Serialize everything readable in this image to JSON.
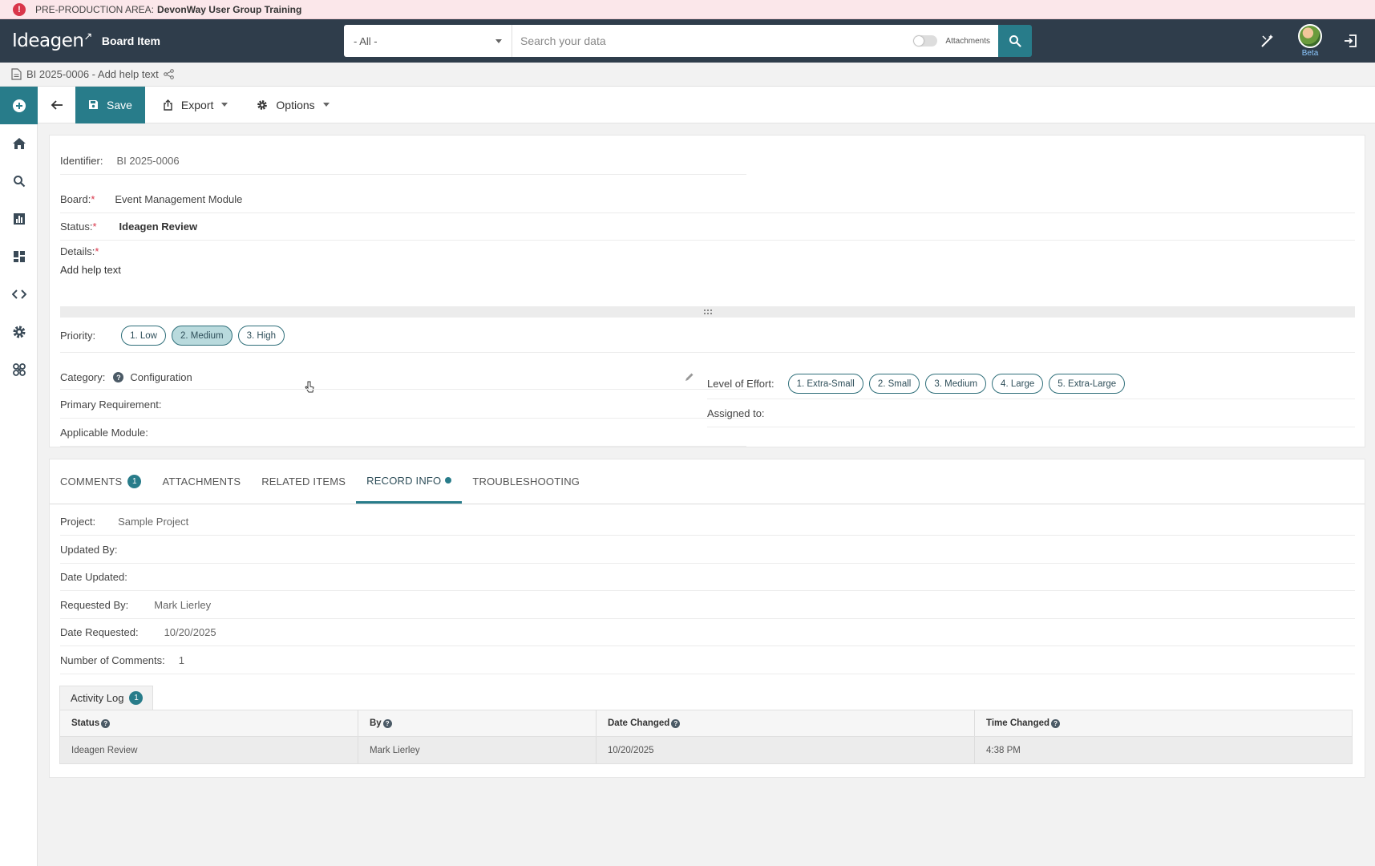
{
  "banner": {
    "label": "PRE-PRODUCTION AREA:",
    "name": "DevonWay User Group Training"
  },
  "header": {
    "logo": "Ideagen",
    "app_title": "Board Item",
    "scope_value": "- All -",
    "search_placeholder": "Search your data",
    "attachments_label": "Attachments",
    "beta_label": "Beta"
  },
  "breadcrumb": {
    "title": "BI 2025-0006 - Add help text"
  },
  "toolbar": {
    "save_label": "Save",
    "export_label": "Export",
    "options_label": "Options"
  },
  "record": {
    "identifier_label": "Identifier:",
    "identifier_value": "BI 2025-0006",
    "board_label": "Board:",
    "board_value": "Event Management Module",
    "status_label": "Status:",
    "status_value": "Ideagen Review",
    "details_label": "Details:",
    "details_value": "Add help text",
    "priority_label": "Priority:",
    "priority_options": [
      "1. Low",
      "2. Medium",
      "3. High"
    ],
    "priority_selected": "2. Medium",
    "category_label": "Category:",
    "category_value": "Configuration",
    "primary_requirement_label": "Primary Requirement:",
    "applicable_module_label": "Applicable Module:",
    "level_of_effort_label": "Level of Effort:",
    "effort_options": [
      "1. Extra-Small",
      "2. Small",
      "3. Medium",
      "4. Large",
      "5. Extra-Large"
    ],
    "assigned_to_label": "Assigned to:"
  },
  "tabs": {
    "comments": "COMMENTS",
    "comments_count": "1",
    "attachments": "ATTACHMENTS",
    "related_items": "RELATED ITEMS",
    "record_info": "RECORD INFO",
    "troubleshooting": "TROUBLESHOOTING"
  },
  "record_info": {
    "project_label": "Project:",
    "project_value": "Sample Project",
    "updated_by_label": "Updated By:",
    "date_updated_label": "Date Updated:",
    "requested_by_label": "Requested By:",
    "requested_by_value": "Mark Lierley",
    "date_requested_label": "Date Requested:",
    "date_requested_value": "10/20/2025",
    "num_comments_label": "Number of Comments:",
    "num_comments_value": "1"
  },
  "activity_log": {
    "tab_label": "Activity Log",
    "count": "1",
    "columns": [
      "Status",
      "By",
      "Date Changed",
      "Time Changed"
    ],
    "rows": [
      [
        "Ideagen Review",
        "Mark Lierley",
        "10/20/2025",
        "4:38 PM"
      ]
    ]
  },
  "colors": {
    "accent": "#287c8a",
    "topbar": "#2f3d4b",
    "banner": "#fbe7ea",
    "required": "#d9364a"
  }
}
